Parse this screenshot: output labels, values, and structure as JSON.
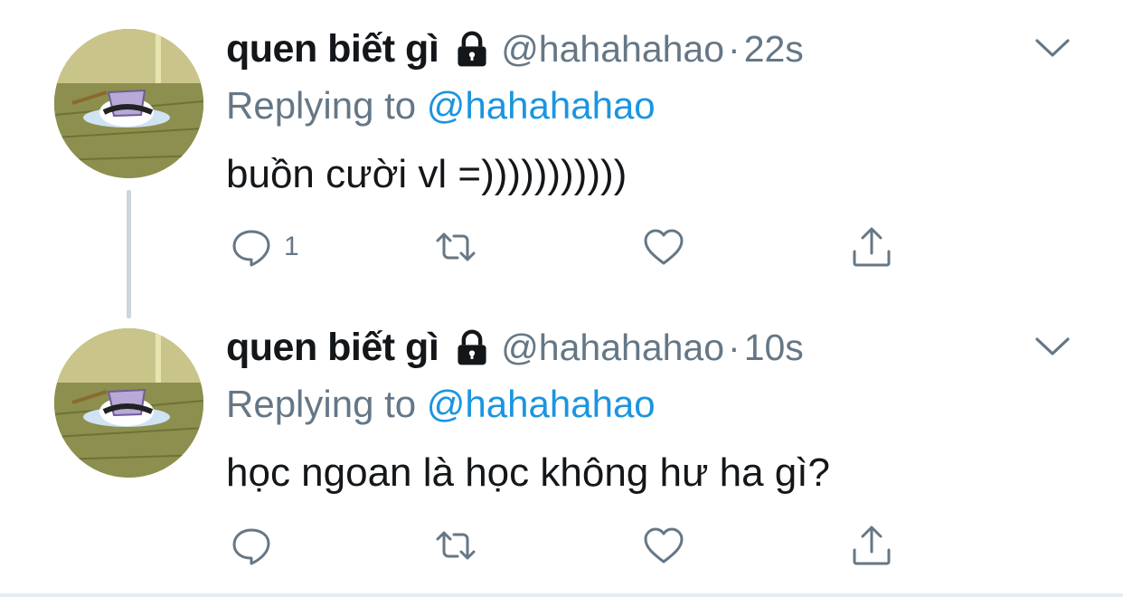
{
  "tweets": [
    {
      "display_name": "quen biết gì",
      "handle": "@hahahahao",
      "separator": "·",
      "time": "22s",
      "replying_prefix": "Replying to",
      "replying_to": "@hahahahao",
      "text": "buồn cười vl =)))))))))))",
      "reply_count": "1",
      "icons": [
        "lock-icon",
        "chevron-down-icon",
        "reply-icon",
        "retweet-icon",
        "like-icon",
        "share-icon"
      ]
    },
    {
      "display_name": "quen biết gì",
      "handle": "@hahahahao",
      "separator": "·",
      "time": "10s",
      "replying_prefix": "Replying to",
      "replying_to": "@hahahahao",
      "text": "học ngoan là học không hư ha gì?",
      "reply_count": "",
      "icons": [
        "lock-icon",
        "chevron-down-icon",
        "reply-icon",
        "retweet-icon",
        "like-icon",
        "share-icon"
      ]
    }
  ],
  "colors": {
    "text_primary": "#14171a",
    "text_secondary": "#657786",
    "accent": "#1b95e0",
    "thread_line": "#cdd6df"
  }
}
